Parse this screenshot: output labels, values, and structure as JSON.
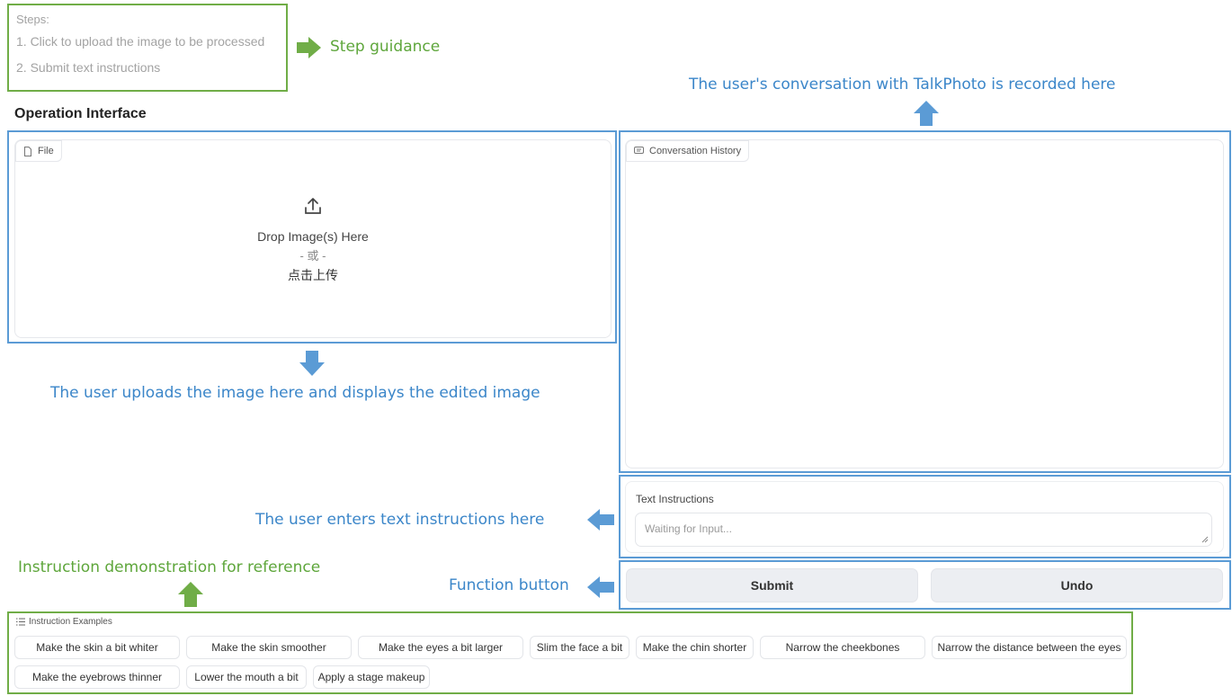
{
  "steps": {
    "title": "Steps:",
    "step1": "1. Click to upload the image to be processed",
    "step2": "2. Submit text instructions"
  },
  "annotations": {
    "step_guidance": "Step guidance",
    "conversation_recorded": "The user's conversation with TalkPhoto is recorded here",
    "upload_here": "The user uploads the image here and displays the edited image",
    "enter_text": "The user enters text instructions here",
    "instruction_demo": "Instruction demonstration for reference",
    "function_button": "Function button"
  },
  "section_title": "Operation Interface",
  "file_panel": {
    "tag": "File",
    "drop_text": "Drop Image(s) Here",
    "or_text": "- 或 -",
    "click_upload": "点击上传"
  },
  "history_panel": {
    "tag": "Conversation History"
  },
  "text_instructions": {
    "label": "Text Instructions",
    "placeholder": "Waiting for Input..."
  },
  "buttons": {
    "submit": "Submit",
    "undo": "Undo"
  },
  "examples": {
    "label": "Instruction Examples",
    "items": [
      "Make the skin a bit whiter",
      "Make the skin smoother",
      "Make the eyes a bit larger",
      "Slim the face a bit",
      "Make the chin shorter",
      "Narrow the cheekbones",
      "Narrow the distance between the eyes",
      "Make the eyebrows thinner",
      "Lower the mouth a bit",
      "Apply a stage makeup"
    ]
  },
  "colors": {
    "green": "#70ad47",
    "blue": "#5b9bd5"
  },
  "icons": [
    "file-icon",
    "chat-icon",
    "upload-icon",
    "list-icon",
    "resize-handle-icon"
  ]
}
